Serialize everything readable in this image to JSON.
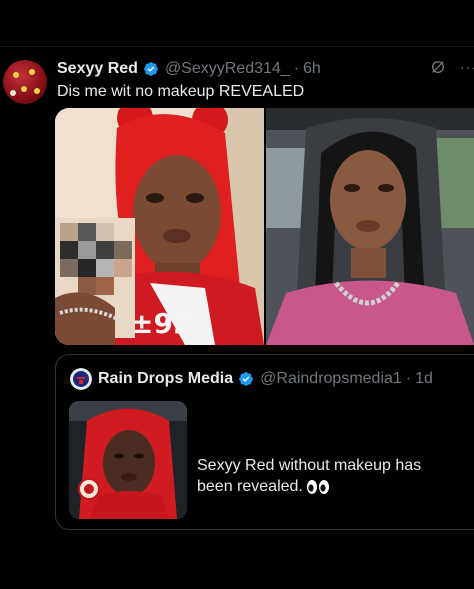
{
  "tweet": {
    "author_name": "Sexyy Red",
    "author_handle": "@SexyyRed314_",
    "separator": "·",
    "time": "6h",
    "text": "Dis me wit no makeup REVEALED",
    "icons": [
      "verified-badge-icon",
      "grok-icon",
      "more-icon"
    ],
    "more_glyph": "···"
  },
  "quote": {
    "author_name": "Rain Drops Media",
    "author_handle": "@Raindropsmedia1",
    "separator": "·",
    "time": "1d",
    "text": "Sexyy Red without makeup has been revealed."
  },
  "colors": {
    "background": "#000000",
    "text": "#e7e9ea",
    "muted": "#71767b",
    "verified": "#1d9bf0",
    "border": "#2f3336"
  }
}
